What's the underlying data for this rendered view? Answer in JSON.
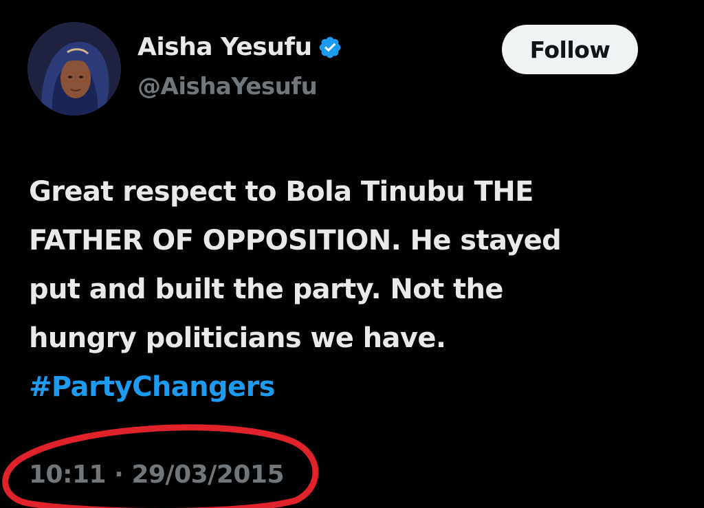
{
  "author": {
    "display_name": "Aisha Yesufu",
    "handle": "@AishaYesufu",
    "verified": true,
    "avatar_icon": "profile-photo"
  },
  "actions": {
    "follow_label": "Follow"
  },
  "tweet": {
    "lines": [
      "Great respect to Bola Tinubu THE",
      "FATHER OF OPPOSITION. He stayed",
      "put and built the party. Not the",
      "hungry politicians we have."
    ],
    "hashtag": "#PartyChangers",
    "timestamp": "10:11 · 29/03/2015"
  },
  "colors": {
    "background": "#000000",
    "primary_text": "#e7e9ea",
    "secondary_text": "#71767b",
    "link": "#1d9bf0",
    "verified_badge": "#1d9bf0",
    "annotation": "#e0232a"
  }
}
